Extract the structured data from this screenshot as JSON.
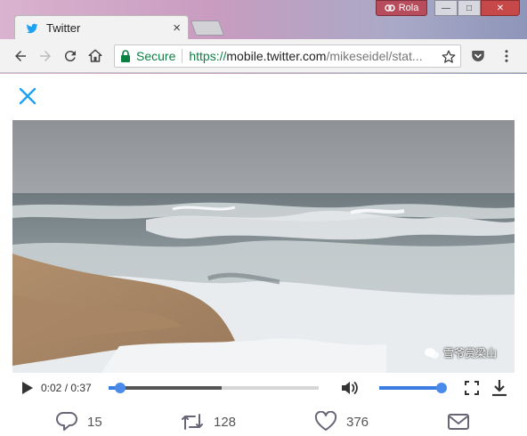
{
  "browser": {
    "tab": {
      "title": "Twitter",
      "close_glyph": "×"
    },
    "profile": {
      "name": "Rola"
    },
    "window_controls": {
      "minimize": "—",
      "maximize": "□",
      "close": "✕"
    },
    "toolbar": {
      "security_label": "Secure",
      "url_scheme": "https://",
      "url_host": "mobile.twitter.com",
      "url_path": "/mikeseidel/stat..."
    }
  },
  "player": {
    "current_time": "0:02",
    "duration": "0:37",
    "time_separator": " / ",
    "progress_fraction": 0.054,
    "buffered_fraction": 0.54,
    "volume_fraction": 1.0
  },
  "tweet_actions": {
    "replies": "15",
    "retweets": "128",
    "likes": "376"
  },
  "watermark": {
    "text": "雪爷赏梁山"
  },
  "colors": {
    "secure_green": "#0b8043",
    "twitter_blue": "#1da1f2",
    "player_blue": "#3b7de0"
  },
  "icons": {
    "favicon": "twitter-bird-icon",
    "back": "arrow-left-icon",
    "forward": "arrow-right-icon",
    "reload": "reload-icon",
    "home": "home-icon",
    "lock": "lock-icon",
    "bookmark": "star-icon",
    "pocket": "pocket-icon",
    "menu": "kebab-menu-icon",
    "close": "close-icon",
    "play": "play-icon",
    "volume": "volume-icon",
    "fullscreen": "fullscreen-icon",
    "download": "download-icon",
    "reply": "reply-icon",
    "retweet": "retweet-icon",
    "like": "heart-icon",
    "dm": "envelope-icon"
  }
}
